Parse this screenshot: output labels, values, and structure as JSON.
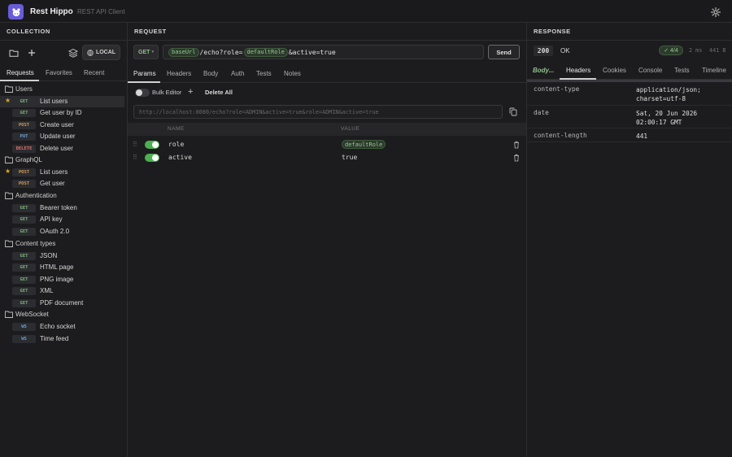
{
  "app": {
    "name": "Rest Hippo",
    "subtitle": "REST API Client"
  },
  "colors": {
    "accent": "#6a5bd8",
    "toggle_on": "#4caf50",
    "get": "#7fb37a",
    "post": "#d69a56",
    "put": "#6b9fd6",
    "delete": "#e06d6d"
  },
  "collection": {
    "title": "COLLECTION",
    "env_label": "LOCAL",
    "tabs": [
      "Requests",
      "Favorites",
      "Recent"
    ],
    "folders": [
      {
        "name": "Users",
        "items": [
          {
            "method": "GET",
            "name": "List users",
            "starred": true,
            "selected": true
          },
          {
            "method": "GET",
            "name": "Get user by ID"
          },
          {
            "method": "POST",
            "name": "Create user"
          },
          {
            "method": "PUT",
            "name": "Update user"
          },
          {
            "method": "DELETE",
            "name": "Delete user"
          }
        ]
      },
      {
        "name": "GraphQL",
        "items": [
          {
            "method": "POST",
            "name": "List users",
            "starred": true
          },
          {
            "method": "POST",
            "name": "Get user"
          }
        ]
      },
      {
        "name": "Authentication",
        "items": [
          {
            "method": "GET",
            "name": "Bearer token"
          },
          {
            "method": "GET",
            "name": "API key"
          },
          {
            "method": "GET",
            "name": "OAuth 2.0"
          }
        ]
      },
      {
        "name": "Content types",
        "items": [
          {
            "method": "GET",
            "name": "JSON"
          },
          {
            "method": "GET",
            "name": "HTML page"
          },
          {
            "method": "GET",
            "name": "PNG image"
          },
          {
            "method": "GET",
            "name": "XML"
          },
          {
            "method": "GET",
            "name": "PDF document"
          }
        ]
      },
      {
        "name": "WebSocket",
        "items": [
          {
            "method": "WS",
            "name": "Echo socket"
          },
          {
            "method": "WS",
            "name": "Time feed"
          }
        ]
      }
    ]
  },
  "request": {
    "title": "REQUEST",
    "method": "GET",
    "url_var1": "baseUrl",
    "url_mid": "/echo?role=",
    "url_var2": "defaultRole",
    "url_end": "&active=true",
    "send_label": "Send",
    "tabs": [
      "Params",
      "Headers",
      "Body",
      "Auth",
      "Tests",
      "Notes"
    ],
    "bulk_editor_label": "Bulk Editor",
    "add_label": "+",
    "delete_all_label": "Delete All",
    "preview_url": "http://localhost:8080/echo?role=ADMIN&active=true&role=ADMIN&active=true",
    "col_name": "NAME",
    "col_value": "VALUE",
    "params": [
      {
        "name": "role",
        "value": "defaultRole",
        "is_var": true,
        "enabled": true
      },
      {
        "name": "active",
        "value": "true",
        "is_var": false,
        "enabled": true
      }
    ]
  },
  "response": {
    "title": "RESPONSE",
    "status_code": "200",
    "status_text": "OK",
    "tests_passed": "✓ 4/4",
    "time": "2 ms",
    "size": "441 B",
    "tabs": [
      "Body...",
      "Headers",
      "Cookies",
      "Console",
      "Tests",
      "Timeline"
    ],
    "headers": [
      {
        "key": "content-type",
        "value": "application/json; charset=utf-8"
      },
      {
        "key": "date",
        "value": "Sat, 20 Jun 2026 02:00:17 GMT"
      },
      {
        "key": "content-length",
        "value": "441"
      }
    ]
  }
}
